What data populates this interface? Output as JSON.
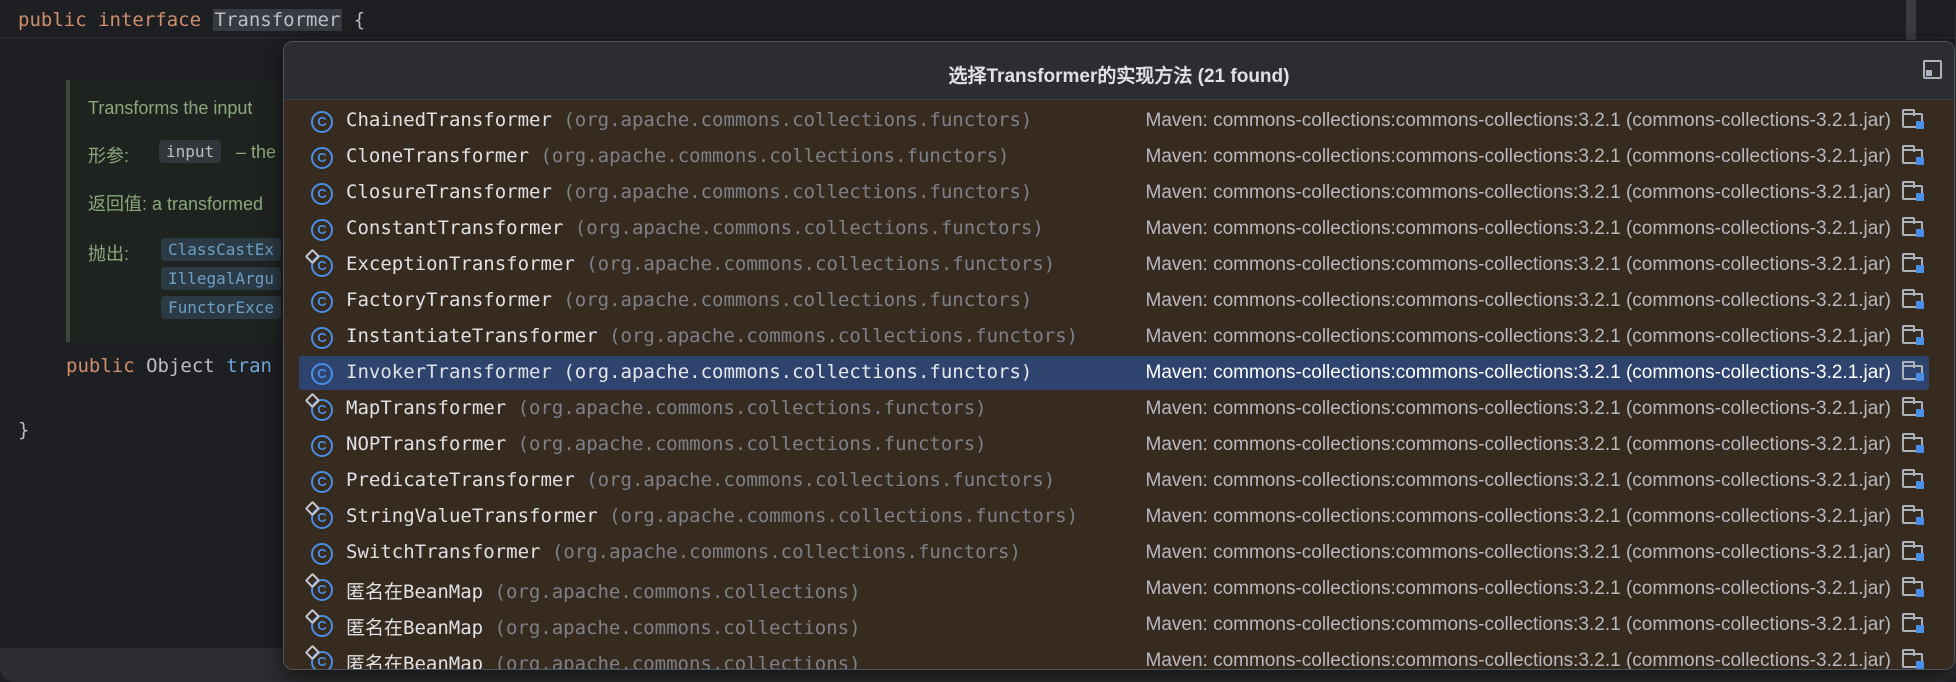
{
  "editor": {
    "line1": {
      "kw1": "public",
      "kw2": "interface",
      "name": "Transformer",
      "brace": "{"
    },
    "doc": {
      "summary": "Transforms the input",
      "params_label": "形参:",
      "param_name": "input",
      "param_desc": "– the",
      "returns": "返回值: a transformed",
      "throws_label": "抛出:",
      "throws": [
        "ClassCastEx",
        "IllegalArgu",
        "FunctorExce"
      ]
    },
    "method": {
      "kw": "public",
      "type": "Object",
      "name": "tran"
    },
    "close_brace": "}"
  },
  "popup": {
    "title": "选择Transformer的实现方法 (21 found)",
    "pin_icon": "pin-icon",
    "selected_index": 7,
    "items": [
      {
        "name": "ChainedTransformer",
        "pkg": "(org.apache.commons.collections.functors)",
        "source": "Maven: commons-collections:commons-collections:3.2.1 (commons-collections-3.2.1.jar)",
        "anon": false
      },
      {
        "name": "CloneTransformer",
        "pkg": "(org.apache.commons.collections.functors)",
        "source": "Maven: commons-collections:commons-collections:3.2.1 (commons-collections-3.2.1.jar)",
        "anon": false
      },
      {
        "name": "ClosureTransformer",
        "pkg": "(org.apache.commons.collections.functors)",
        "source": "Maven: commons-collections:commons-collections:3.2.1 (commons-collections-3.2.1.jar)",
        "anon": false
      },
      {
        "name": "ConstantTransformer",
        "pkg": "(org.apache.commons.collections.functors)",
        "source": "Maven: commons-collections:commons-collections:3.2.1 (commons-collections-3.2.1.jar)",
        "anon": false
      },
      {
        "name": "ExceptionTransformer",
        "pkg": "(org.apache.commons.collections.functors)",
        "source": "Maven: commons-collections:commons-collections:3.2.1 (commons-collections-3.2.1.jar)",
        "anon": true
      },
      {
        "name": "FactoryTransformer",
        "pkg": "(org.apache.commons.collections.functors)",
        "source": "Maven: commons-collections:commons-collections:3.2.1 (commons-collections-3.2.1.jar)",
        "anon": false
      },
      {
        "name": "InstantiateTransformer",
        "pkg": "(org.apache.commons.collections.functors)",
        "source": "Maven: commons-collections:commons-collections:3.2.1 (commons-collections-3.2.1.jar)",
        "anon": false
      },
      {
        "name": "InvokerTransformer",
        "pkg": "(org.apache.commons.collections.functors)",
        "source": "Maven: commons-collections:commons-collections:3.2.1 (commons-collections-3.2.1.jar)",
        "anon": false
      },
      {
        "name": "MapTransformer",
        "pkg": "(org.apache.commons.collections.functors)",
        "source": "Maven: commons-collections:commons-collections:3.2.1 (commons-collections-3.2.1.jar)",
        "anon": true
      },
      {
        "name": "NOPTransformer",
        "pkg": "(org.apache.commons.collections.functors)",
        "source": "Maven: commons-collections:commons-collections:3.2.1 (commons-collections-3.2.1.jar)",
        "anon": false
      },
      {
        "name": "PredicateTransformer",
        "pkg": "(org.apache.commons.collections.functors)",
        "source": "Maven: commons-collections:commons-collections:3.2.1 (commons-collections-3.2.1.jar)",
        "anon": false
      },
      {
        "name": "StringValueTransformer",
        "pkg": "(org.apache.commons.collections.functors)",
        "source": "Maven: commons-collections:commons-collections:3.2.1 (commons-collections-3.2.1.jar)",
        "anon": true
      },
      {
        "name": "SwitchTransformer",
        "pkg": "(org.apache.commons.collections.functors)",
        "source": "Maven: commons-collections:commons-collections:3.2.1 (commons-collections-3.2.1.jar)",
        "anon": false
      },
      {
        "name": "匿名在BeanMap",
        "pkg": "(org.apache.commons.collections)",
        "source": "Maven: commons-collections:commons-collections:3.2.1 (commons-collections-3.2.1.jar)",
        "anon": true
      },
      {
        "name": "匿名在BeanMap",
        "pkg": "(org.apache.commons.collections)",
        "source": "Maven: commons-collections:commons-collections:3.2.1 (commons-collections-3.2.1.jar)",
        "anon": true
      },
      {
        "name": "匿名在BeanMap",
        "pkg": "(org.apache.commons.collections)",
        "source": "Maven: commons-collections:commons-collections:3.2.1 (commons-collections-3.2.1.jar)",
        "anon": true
      }
    ],
    "class_icon": "class-icon",
    "library_icon": "library-folder-icon"
  }
}
